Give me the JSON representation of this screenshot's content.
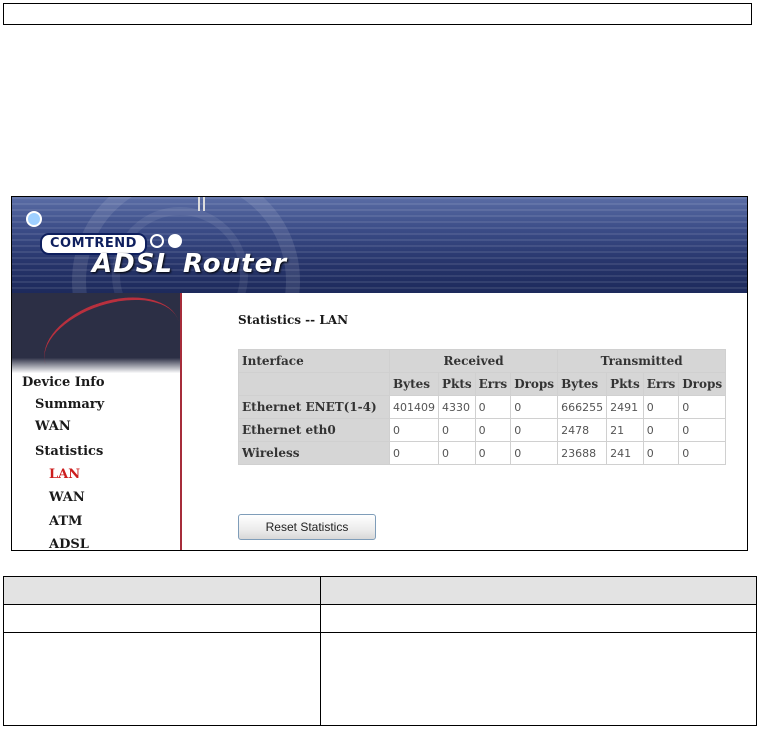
{
  "banner": {
    "brand": "COMTREND",
    "product": "ADSL Router"
  },
  "sidebar": {
    "items": [
      {
        "label": "Device Info",
        "level": 0,
        "active": false
      },
      {
        "label": "Summary",
        "level": 1,
        "active": false
      },
      {
        "label": "WAN",
        "level": 1,
        "active": false
      },
      {
        "label": "Statistics",
        "level": 1,
        "active": false
      },
      {
        "label": "LAN",
        "level": 2,
        "active": true
      },
      {
        "label": "WAN",
        "level": 2,
        "active": false
      },
      {
        "label": "ATM",
        "level": 2,
        "active": false
      },
      {
        "label": "ADSL",
        "level": 2,
        "active": false
      }
    ]
  },
  "main": {
    "title": "Statistics -- LAN",
    "table": {
      "group_headers": {
        "interface": "Interface",
        "received": "Received",
        "transmitted": "Transmitted"
      },
      "sub_headers": [
        "Bytes",
        "Pkts",
        "Errs",
        "Drops",
        "Bytes",
        "Pkts",
        "Errs",
        "Drops"
      ],
      "rows": [
        {
          "interface": "Ethernet ENET(1-4)",
          "values": [
            "401409",
            "4330",
            "0",
            "0",
            "666255",
            "2491",
            "0",
            "0"
          ]
        },
        {
          "interface": "Ethernet eth0",
          "values": [
            "0",
            "0",
            "0",
            "0",
            "2478",
            "21",
            "0",
            "0"
          ]
        },
        {
          "interface": "Wireless",
          "values": [
            "0",
            "0",
            "0",
            "0",
            "23688",
            "241",
            "0",
            "0"
          ]
        }
      ]
    },
    "reset_label": "Reset Statistics"
  },
  "colors": {
    "active_nav": "#cc1d1d",
    "header_gray": "#d6d6d6",
    "banner_blue": "#26346a"
  }
}
